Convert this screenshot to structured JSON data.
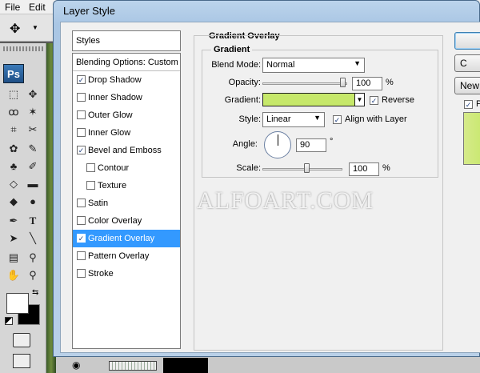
{
  "app": {
    "menu": [
      "File",
      "Edit"
    ],
    "logo": "Ps"
  },
  "dialog": {
    "title": "Layer Style",
    "styles_header": "Styles",
    "blending_options": "Blending Options: Custom",
    "styles": [
      {
        "label": "Drop Shadow",
        "checked": true,
        "sub": false,
        "selected": false
      },
      {
        "label": "Inner Shadow",
        "checked": false,
        "sub": false,
        "selected": false
      },
      {
        "label": "Outer Glow",
        "checked": false,
        "sub": false,
        "selected": false
      },
      {
        "label": "Inner Glow",
        "checked": false,
        "sub": false,
        "selected": false
      },
      {
        "label": "Bevel and Emboss",
        "checked": true,
        "sub": false,
        "selected": false
      },
      {
        "label": "Contour",
        "checked": false,
        "sub": true,
        "selected": false
      },
      {
        "label": "Texture",
        "checked": false,
        "sub": true,
        "selected": false
      },
      {
        "label": "Satin",
        "checked": false,
        "sub": false,
        "selected": false
      },
      {
        "label": "Color Overlay",
        "checked": false,
        "sub": false,
        "selected": false
      },
      {
        "label": "Gradient Overlay",
        "checked": true,
        "sub": false,
        "selected": true
      },
      {
        "label": "Pattern Overlay",
        "checked": false,
        "sub": false,
        "selected": false
      },
      {
        "label": "Stroke",
        "checked": false,
        "sub": false,
        "selected": false
      }
    ],
    "gradient_overlay": {
      "section_title": "Gradient Overlay",
      "group_title": "Gradient",
      "blend_mode_label": "Blend Mode:",
      "blend_mode_value": "Normal",
      "opacity_label": "Opacity:",
      "opacity_value": "100",
      "opacity_unit": "%",
      "opacity_level": 1.0,
      "gradient_label": "Gradient:",
      "gradient_color": "#c6e86a",
      "reverse_label": "Reverse",
      "reverse_checked": true,
      "style_label": "Style:",
      "style_value": "Linear",
      "align_label": "Align with Layer",
      "align_checked": true,
      "angle_label": "Angle:",
      "angle_value": "90",
      "angle_unit": "°",
      "scale_label": "Scale:",
      "scale_value": "100",
      "scale_unit": "%",
      "scale_level": 0.5
    },
    "buttons": {
      "ok": "",
      "cancel": "C",
      "new_style": "New",
      "preview": "P"
    }
  },
  "watermark": "ALFOART.COM"
}
